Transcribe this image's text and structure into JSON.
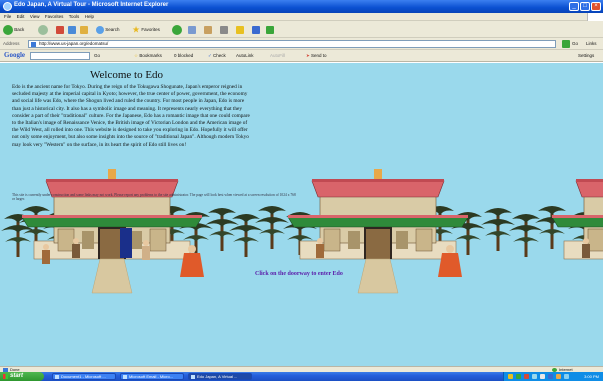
{
  "window": {
    "title": "Edo Japan, A Virtual Tour - Microsoft Internet Explorer"
  },
  "menu": [
    "File",
    "Edit",
    "View",
    "Favorites",
    "Tools",
    "Help"
  ],
  "toolbar": {
    "back": "Back",
    "search": "Search",
    "favorites": "Favorites"
  },
  "address": {
    "label": "Address",
    "url": "http://www.us-japan.org/edomatsu/",
    "go": "Go",
    "links": "Links"
  },
  "googlebar": {
    "logo": "Google",
    "go_label": "Go",
    "items": [
      "Bookmarks",
      "0 blocked",
      "Check",
      "AutoLink",
      "AutoFill",
      "Send to"
    ],
    "settings": "Settings"
  },
  "page": {
    "heading": "Welcome to Edo",
    "paragraph": "Edo is the ancient name for Tokyo. During the reign of the Tokugawa Shogunate, Japan's emperor reigned in secluded majesty at the imperial capital in Kyoto; however, the true center of power, government, the economy and social life was Edo, where the Shogun lived and ruled the country. For most people in Japan, Edo is more than just a historical city. It also has a symbolic image and meaning. It represents nearly everything that they consider a part of their \"traditional\" culture. For the Japanese, Edo has a romantic image that one could compare to the Italian's image of Renaissance Venice, the British image of Victorian London and the American image of the Wild West, all rolled into one. This website is designed to take you exploring in Edo. Hopefully it will offer not only some enjoyment, but also some insights into the source of \"traditional Japan\". Although modern Tokyo may look very \"Western\" on the surface, in its heart the spirit of Edo still lives on!",
    "small_note": "This site is currently under construction and some links may not work. Please report any problems to the site administrator. The page will look best when viewed at a screen resolution of 1024 x 768 or larger.",
    "enter_link": "Click on the doorway to enter Edo"
  },
  "status": {
    "left": "Done",
    "right": "Internet"
  },
  "taskbar": {
    "start": "start",
    "tasks": [
      "Document1 - Microsoft ...",
      "Microsoft Email - Micro...",
      "Edo Japan, A Virtual ..."
    ],
    "clock": "3:00 PM"
  },
  "colors": {
    "sky": "#9ad9ec",
    "roof": "#d9646a",
    "link": "#5a1aa8"
  }
}
